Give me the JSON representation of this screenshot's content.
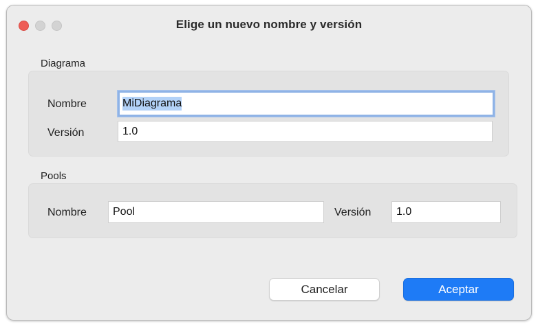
{
  "window": {
    "title": "Elige un nuevo nombre y versión"
  },
  "diagram_group": {
    "label": "Diagrama",
    "name_label": "Nombre",
    "name_value": "MiDiagrama",
    "version_label": "Versión",
    "version_value": "1.0"
  },
  "pools_group": {
    "label": "Pools",
    "name_label": "Nombre",
    "name_value": "Pool",
    "version_label": "Versión",
    "version_value": "1.0"
  },
  "buttons": {
    "cancel_label": "Cancelar",
    "accept_label": "Aceptar"
  },
  "colors": {
    "accent": "#1e7bf6",
    "close_light": "#ee5d56",
    "selection": "#b3d2f8"
  }
}
